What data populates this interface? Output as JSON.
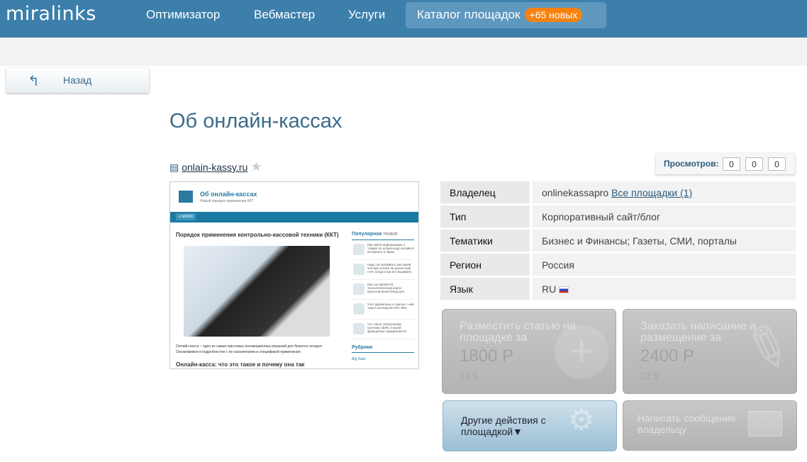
{
  "header": {
    "logo": "miralinks",
    "nav": [
      {
        "label": "Оптимизатор"
      },
      {
        "label": "Вебмастер"
      },
      {
        "label": "Услуги"
      },
      {
        "label": "Каталог площадок",
        "badge": "+65 новых"
      }
    ]
  },
  "back_label": "Назад",
  "page_title": "Об онлайн-кассах",
  "site": {
    "domain": "onlain-kassy.ru"
  },
  "thumbnail": {
    "site_title": "Об онлайн-кассах",
    "tagline": "Новый порядок применения ККТ",
    "menu": "≡ МЕНЮ",
    "headline": "Порядок применения контрольно-кассовой техники (ККТ)",
    "paragraph": "Онлайн-касса – одно из самых массовых инновационных решений для бизнеса сегодня. Ознакомимся в подробностях с ее назначением и спецификой применения.",
    "subheadline": "Онлайн-касса: что это такое и почему она так",
    "tab_popular": "Популярное",
    "tab_new": "Новое",
    "side_items": [
      "Как найти информацию о товаре по штрих-коду онлайн в интернете и через",
      "Надо ли пробивать кассовый чек при оплате на расчетный счет, когда и как его выдавать",
      "Как составляется технологическая карта приготовления блюд для",
      "Учет древесины и сделок с ней через систему ЕГАИС ЛЕС",
      "Что такое электронная система СБИС и какой функционал предлагается"
    ],
    "rubrics": "Рубрики",
    "rubric_first": "Big Data"
  },
  "views": {
    "label": "Просмотров:",
    "values": [
      "0",
      "0",
      "0"
    ]
  },
  "info": [
    {
      "key": "Владелец",
      "value": "onlinekassapro",
      "link": "Все площадки (1)"
    },
    {
      "key": "Тип",
      "value": "Корпоративный сайт/блог"
    },
    {
      "key": "Тематики",
      "value": "Бизнес и Финансы; Газеты, СМИ, порталы"
    },
    {
      "key": "Регион",
      "value": "Россия"
    },
    {
      "key": "Язык",
      "value": "RU"
    }
  ],
  "actions": {
    "place": {
      "title": "Разместить статью на площадке за",
      "price": "1800 Р",
      "usd": "24 $"
    },
    "order": {
      "title": "Заказать написание и размещение за",
      "price": "2400 Р",
      "usd": "32 $"
    },
    "other": {
      "label": "Другие действия с площадкой▼"
    },
    "message": {
      "label": "Написать сообщение владельцу"
    }
  }
}
